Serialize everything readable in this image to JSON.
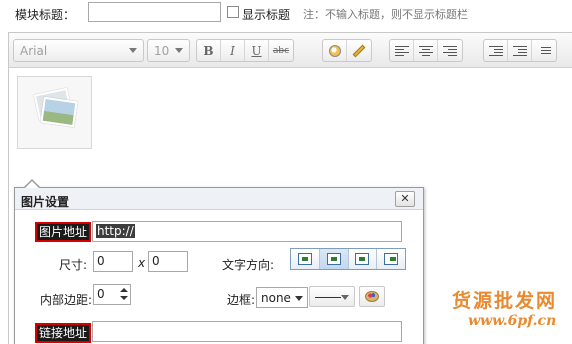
{
  "module_title": {
    "label": "模块标题：",
    "value": "",
    "show_title_label": "显示标题",
    "show_title_checked": false,
    "note": "注：不输入标题，则不显示标题栏"
  },
  "toolbar": {
    "font_family": "Arial",
    "font_size": "10",
    "bold": "B",
    "italic": "I",
    "underline": "U",
    "strikethrough": "abc"
  },
  "image_popup": {
    "title": "图片设置",
    "close": "✕",
    "image_url_label": "图片地址",
    "image_url_value": "http://",
    "size_label": "尺寸:",
    "width_value": "0",
    "times_sign": "x",
    "height_value": "0",
    "text_direction_label": "文字方向:",
    "padding_label": "内部边距:",
    "padding_value": "0",
    "border_label": "边框:",
    "border_value": "none",
    "link_url_label": "链接地址",
    "link_url_value": ""
  },
  "watermark": {
    "text": "货源批发网",
    "url": "www.6pf.cn"
  },
  "colors": {
    "highlight_red": "#d60000",
    "watermark_orange": "#e98a2f",
    "active_direction": "#c3d7ee"
  }
}
